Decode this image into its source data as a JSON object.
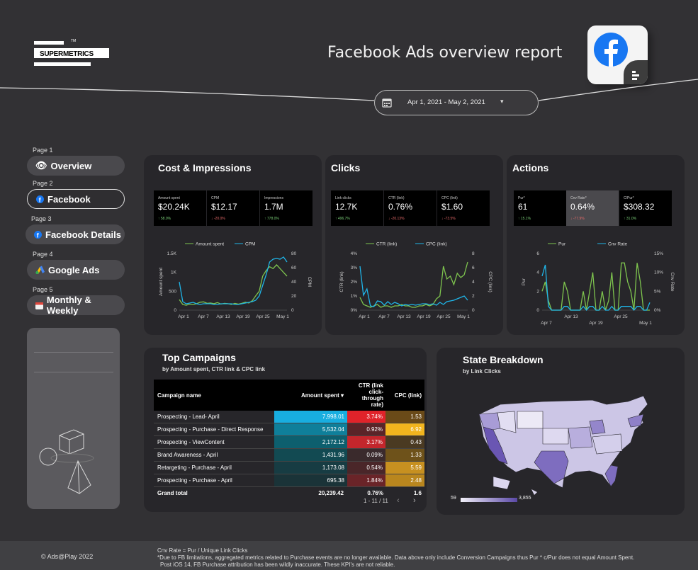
{
  "header": {
    "logo_text": "SUPERMETRICS",
    "logo_tm": "TM",
    "title": "Facebook Ads overview report",
    "date_range": "Apr 1, 2021 - May 2, 2021"
  },
  "nav": [
    {
      "page": "Page 1",
      "label": "Overview",
      "icon": "eye-icon"
    },
    {
      "page": "Page 2",
      "label": "Facebook",
      "icon": "facebook-icon"
    },
    {
      "page": "Page 3",
      "label": "Facebook Details",
      "icon": "facebook-icon"
    },
    {
      "page": "Page 4",
      "label": "Google Ads",
      "icon": "google-ads-icon"
    },
    {
      "page": "Page 5",
      "label": "Monthly & Weekly",
      "icon": "calendar-icon"
    }
  ],
  "cards": {
    "cost": {
      "title": "Cost & Impressions",
      "kpis": [
        {
          "label": "Amount spent",
          "value": "$20.24K",
          "change": "↑ 58.0%",
          "dir": "up"
        },
        {
          "label": "CPM",
          "value": "$12.17",
          "change": "↓ -20.0%",
          "dir": "down"
        },
        {
          "label": "Impressions",
          "value": "1.7M",
          "change": "↑ 778.0%",
          "dir": "up"
        }
      ]
    },
    "clicks": {
      "title": "Clicks",
      "kpis": [
        {
          "label": "Link clicks",
          "value": "12.7K",
          "change": "↑ 496.7%",
          "dir": "up"
        },
        {
          "label": "CTR (link)",
          "value": "0.76%",
          "change": "↓ -20.13%",
          "dir": "down"
        },
        {
          "label": "CPC (link)",
          "value": "$1.60",
          "change": "↓ -73.5%",
          "dir": "down"
        }
      ]
    },
    "actions": {
      "title": "Actions",
      "kpis": [
        {
          "label": "Pur*",
          "value": "61",
          "change": "↑ 15.1%",
          "dir": "up"
        },
        {
          "label": "Cnv Rate*",
          "value": "0.64%",
          "change": "↓ -77.9%",
          "dir": "down"
        },
        {
          "label": "C/Pur*",
          "value": "$308.32",
          "change": "↑ 31.0%",
          "dir": "up"
        }
      ]
    }
  },
  "chart_data": [
    {
      "type": "line",
      "x": [
        "Apr 1",
        "Apr 7",
        "Apr 13",
        "Apr 19",
        "Apr 25",
        "May 1"
      ],
      "series": [
        {
          "name": "Amount spent",
          "color": "#7ec44e",
          "axis": "left",
          "values": [
            280,
            150,
            130,
            160,
            150,
            170,
            210,
            220,
            180,
            190,
            170,
            200,
            160,
            180,
            170,
            150,
            180,
            160,
            180,
            210,
            190,
            250,
            380,
            500,
            900,
            1050,
            1150,
            1100,
            1200,
            1100,
            1000,
            900
          ]
        },
        {
          "name": "CPM",
          "color": "#1fb5e8",
          "axis": "right",
          "values": [
            40,
            12,
            9,
            10,
            11,
            9,
            8,
            9,
            9,
            9,
            8,
            8,
            9,
            9,
            9,
            9,
            8,
            8,
            9,
            10,
            11,
            12,
            14,
            20,
            35,
            50,
            68,
            72,
            73,
            72,
            75,
            68
          ]
        }
      ],
      "ylabel_left": "Amount spent",
      "ylabel_right": "CPM",
      "yticks_left": [
        "1.5K",
        "1K",
        "500",
        "0"
      ],
      "yticks_right": [
        "80",
        "60",
        "40",
        "20",
        "0"
      ]
    },
    {
      "type": "line",
      "x": [
        "Apr 1",
        "Apr 7",
        "Apr 13",
        "Apr 19",
        "Apr 25",
        "May 1"
      ],
      "series": [
        {
          "name": "CTR (link)",
          "color": "#7ec44e",
          "axis": "left",
          "values": [
            0.9,
            0.4,
            0.3,
            0.2,
            0.3,
            0.4,
            0.2,
            0.3,
            0.3,
            0.2,
            0.3,
            0.3,
            0.4,
            0.3,
            0.3,
            0.2,
            0.2,
            0.3,
            0.3,
            0.4,
            0.3,
            0.4,
            0.8,
            1.0,
            3.1,
            2.2,
            2.4,
            1.8,
            2.6,
            2.3,
            2.5,
            3.4
          ]
        },
        {
          "name": "CPC (link)",
          "color": "#1fb5e8",
          "axis": "right",
          "values": [
            6.2,
            2.1,
            3.0,
            0.6,
            0.5,
            1.3,
            1.2,
            0.7,
            1.2,
            0.8,
            1.1,
            0.9,
            0.6,
            0.8,
            0.7,
            0.8,
            0.7,
            0.8,
            0.9,
            0.9,
            0.8,
            0.9,
            0.7,
            1.1,
            0.8,
            1.2,
            1.3,
            1.4,
            1.6,
            1.8,
            2.0,
            1.4
          ]
        }
      ],
      "ylabel_left": "CTR (link)",
      "ylabel_right": "CPC (link)",
      "yticks_left": [
        "4%",
        "3%",
        "2%",
        "1%",
        "0%"
      ],
      "yticks_right": [
        "8",
        "6",
        "4",
        "2",
        "0"
      ]
    },
    {
      "type": "line",
      "x": [
        "Apr 7",
        "Apr 13",
        "Apr 19",
        "Apr 25",
        "May 1"
      ],
      "series": [
        {
          "name": "Pur",
          "color": "#7ec44e",
          "axis": "left",
          "values": [
            2,
            3,
            1,
            0,
            0,
            0,
            0,
            3,
            2,
            0,
            0,
            0,
            0,
            2,
            0,
            2,
            4,
            0,
            0,
            2,
            0,
            1,
            4,
            0,
            0,
            5,
            5,
            3,
            2,
            0,
            5,
            3,
            0,
            0,
            0
          ]
        },
        {
          "name": "Cnv Rate",
          "color": "#1fb5e8",
          "axis": "right",
          "values": [
            9,
            12,
            1,
            0,
            0,
            0,
            0,
            1,
            1,
            0,
            0,
            0,
            0,
            1,
            0,
            1,
            1,
            0,
            0,
            1,
            0,
            0,
            1,
            0,
            0,
            1,
            1,
            1,
            1,
            0,
            1,
            1,
            0,
            0,
            2
          ]
        }
      ],
      "ylabel_left": "Pur",
      "ylabel_right": "Cnv Rate",
      "yticks_left": [
        "6",
        "4",
        "2",
        "0"
      ],
      "yticks_right": [
        "15%",
        "10%",
        "5%",
        "0%"
      ]
    }
  ],
  "table": {
    "title": "Top Campaigns",
    "subtitle": "by  Amount spent, CTR link & CPC link",
    "columns": [
      "Campaign name",
      "Amount spent  ▾",
      "CTR (link click-through rate)",
      "CPC (link)"
    ],
    "rows": [
      {
        "name": "Prospecting - Lead- April",
        "amount": "7,998.01",
        "ctr": "3.74%",
        "cpc": "1.53"
      },
      {
        "name": "Prospecting - Purchase - Direct Response",
        "amount": "5,532.04",
        "ctr": "0.92%",
        "cpc": "6.92"
      },
      {
        "name": "Prospecting - ViewContent",
        "amount": "2,172.12",
        "ctr": "3.17%",
        "cpc": "0.43"
      },
      {
        "name": "Brand Awareness - April",
        "amount": "1,431.96",
        "ctr": "0.09%",
        "cpc": "1.33"
      },
      {
        "name": "Retargeting - Purchase - April",
        "amount": "1,173.08",
        "ctr": "0.54%",
        "cpc": "5.59"
      },
      {
        "name": "Prospecting - Purchase - April",
        "amount": "695.38",
        "ctr": "1.84%",
        "cpc": "2.48"
      }
    ],
    "total": {
      "name": "Grand total",
      "amount": "20,239.42",
      "ctr": "0.76%",
      "cpc": "1.6"
    },
    "pagination": "1 - 11 / 11"
  },
  "map": {
    "title": "State Breakdown",
    "subtitle": "by Link Clicks",
    "legend_min": "59",
    "legend_max": "3,855"
  },
  "footer": {
    "copyright": "© Ads@Play 2022",
    "note1": "Cnv Rate = Pur / Unique Link Clicks",
    "note2": "*Due to FB limitations, aggregated metrics related to Purchase events are no longer available. Data above only include Conversion Campaigns thus Pur * c/Pur does not equal Amount Spent.",
    "note3": "Post iOS 14, FB Purchase attribution has been wildly inaccurate. These KPI's are not reliable."
  }
}
